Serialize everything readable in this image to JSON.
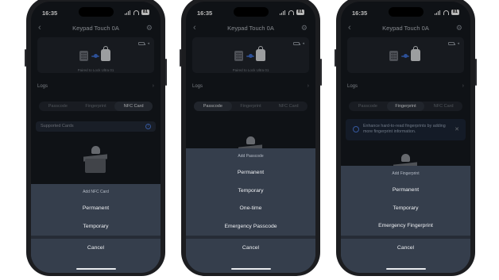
{
  "phones": [
    {
      "status": {
        "time": "16:35",
        "battery": "81"
      },
      "title": "Keypad Touch 0A",
      "paired": "Paired to Lock Ultra 01",
      "logs_label": "Logs",
      "tabs": [
        "Passcode",
        "Fingerprint",
        "NFC Card"
      ],
      "active_tab": "NFC Card",
      "supported_cards": "Supported Cards",
      "sheet": {
        "title": "Add NFC Card",
        "options": [
          "Permanent",
          "Temporary"
        ],
        "cancel": "Cancel"
      }
    },
    {
      "status": {
        "time": "16:35",
        "battery": "81"
      },
      "title": "Keypad Touch 0A",
      "paired": "Paired to Lock Ultra 01",
      "logs_label": "Logs",
      "tabs": [
        "Passcode",
        "Fingerprint",
        "NFC Card"
      ],
      "active_tab": "Passcode",
      "sheet": {
        "title": "Add Passcode",
        "options": [
          "Permanent",
          "Temporary",
          "One-time",
          "Emergency Passcode"
        ],
        "cancel": "Cancel"
      }
    },
    {
      "status": {
        "time": "16:35",
        "battery": "81"
      },
      "title": "Keypad Touch 0A",
      "paired": "",
      "logs_label": "Logs",
      "tabs": [
        "Passcode",
        "Fingerprint",
        "NFC Card"
      ],
      "active_tab": "Fingerprint",
      "banner": "Enhance hard-to-read fingerprints by adding more fingerprint information.",
      "sheet": {
        "title": "Add Fingerprint",
        "options": [
          "Permanent",
          "Temporary",
          "Emergency Fingerprint"
        ],
        "cancel": "Cancel"
      }
    }
  ],
  "colors": {
    "screen_bg": "#15191f",
    "sheet_bg": "#353e4c",
    "accent": "#4a79d9"
  },
  "icons": [
    "back-chevron-icon",
    "gear-icon",
    "keypad-icon",
    "lock-icon",
    "battery-icon",
    "chevron-right-icon",
    "info-icon",
    "fingerprint-icon",
    "close-icon",
    "empty-box-icon"
  ]
}
